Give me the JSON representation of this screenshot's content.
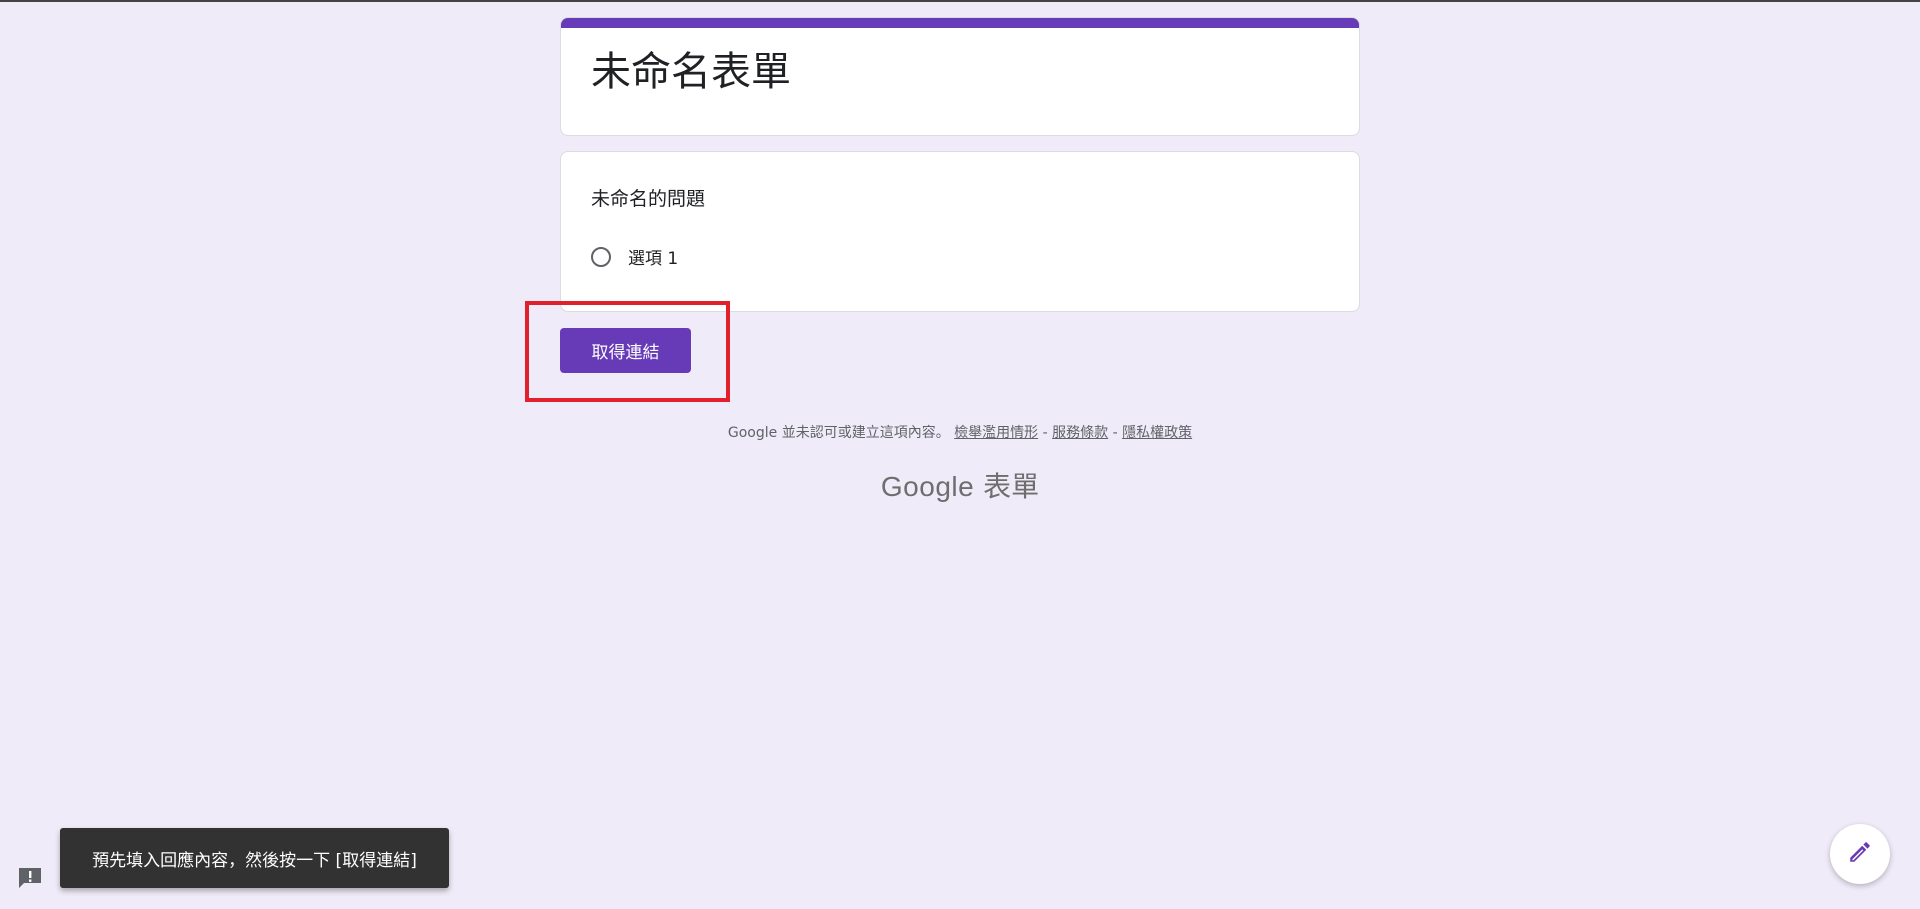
{
  "form": {
    "title": "未命名表單",
    "accent_color": "#673ab7",
    "question": {
      "title": "未命名的問題",
      "options": [
        "選項 1"
      ]
    }
  },
  "actions": {
    "get_link_label": "取得連結"
  },
  "footer": {
    "disclaimer_prefix": "Google 並未認可或建立這項內容。",
    "links": [
      "檢舉濫用情形",
      "服務條款",
      "隱私權政策"
    ],
    "separator": "-",
    "brand_google": "Google",
    "brand_product": "表單"
  },
  "snackbar": {
    "message": "預先填入回應內容，然後按一下 [取得連結]"
  },
  "icons": {
    "feedback": "feedback-icon",
    "edit": "edit-pencil-icon"
  }
}
